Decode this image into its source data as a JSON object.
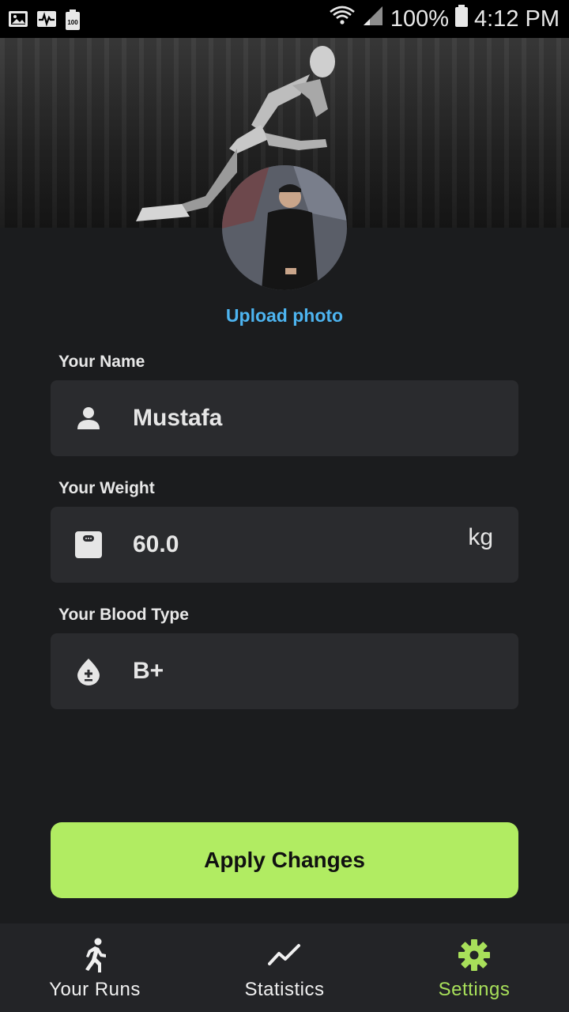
{
  "status_bar": {
    "battery_percent": "100%",
    "time": "4:12 PM",
    "left_icons": [
      "image-icon",
      "activity-icon",
      "battery-saver-icon"
    ],
    "battery_saver_label": "100"
  },
  "profile": {
    "upload_label": "Upload photo"
  },
  "fields": {
    "name": {
      "label": "Your Name",
      "value": "Mustafa",
      "icon": "person-icon"
    },
    "weight": {
      "label": "Your Weight",
      "value": "60.0",
      "unit": "kg",
      "icon": "scale-icon"
    },
    "blood": {
      "label": "Your Blood Type",
      "value": "B+",
      "icon": "blood-drop-icon"
    }
  },
  "apply_button": {
    "label": "Apply Changes"
  },
  "nav": {
    "items": [
      {
        "label": "Your Runs",
        "icon": "runner-icon",
        "active": false
      },
      {
        "label": "Statistics",
        "icon": "trend-icon",
        "active": false
      },
      {
        "label": "Settings",
        "icon": "gear-icon",
        "active": true
      }
    ]
  },
  "colors": {
    "accent": "#b1ec62",
    "active_nav": "#a8e05a",
    "link": "#4db4f0",
    "background": "#1b1c1e",
    "field_bg": "#2a2b2e"
  }
}
